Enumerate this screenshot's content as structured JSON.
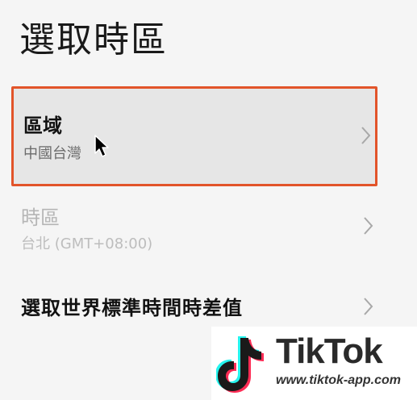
{
  "header": {
    "title": "選取時區"
  },
  "settings": {
    "region": {
      "title": "區域",
      "value": "中國台灣",
      "highlight_color": "#e2542a"
    },
    "timezone": {
      "title": "時區",
      "value": "台北 (GMT+08:00)"
    },
    "gmt_offset": {
      "title": "選取世界標準時間時差值"
    }
  },
  "icons": {
    "chevron": "chevron-right-icon",
    "cursor": "mouse-pointer-icon"
  },
  "watermark": {
    "brand": "TikTok",
    "url": "www.tiktok-app.com"
  }
}
